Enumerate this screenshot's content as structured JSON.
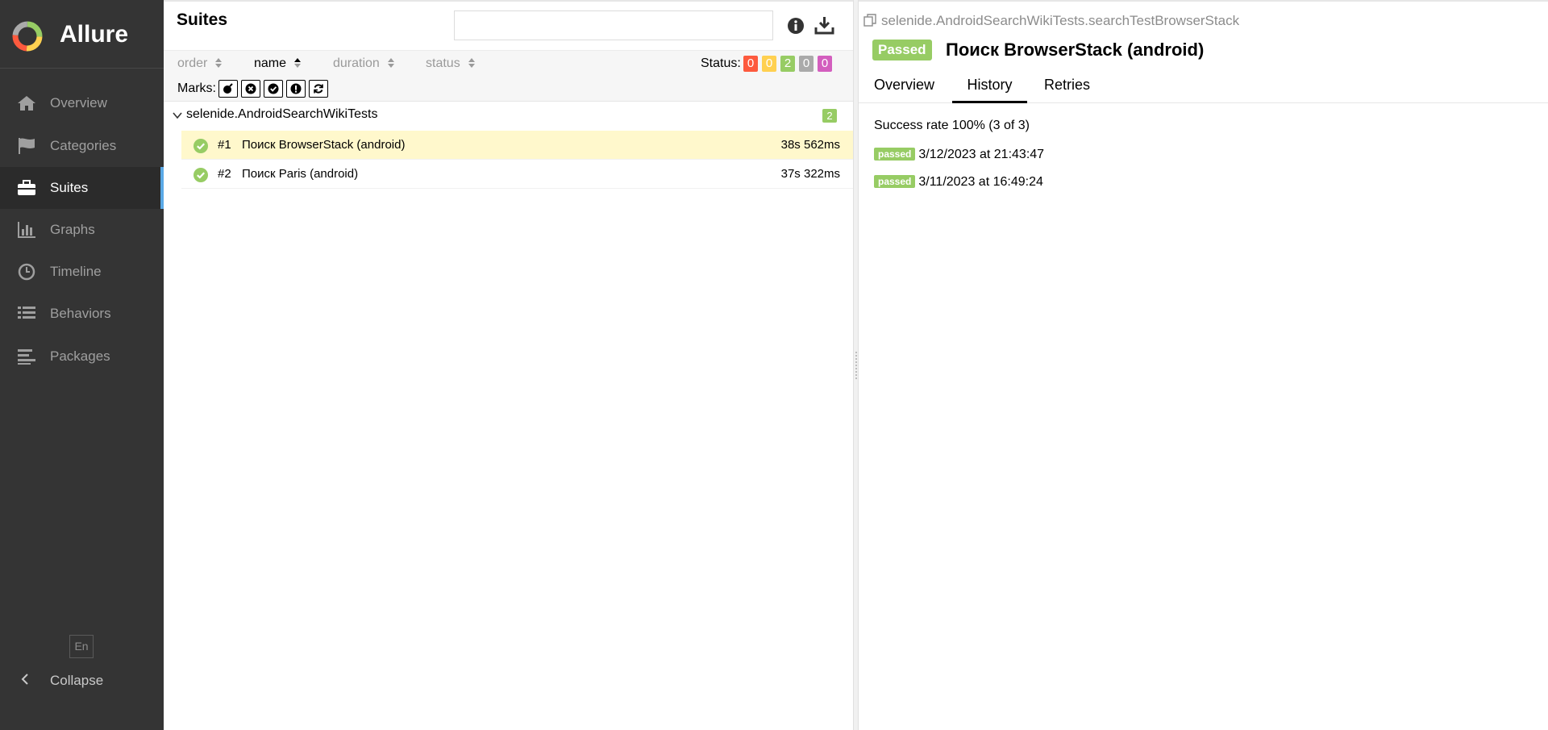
{
  "app": {
    "brand": "Allure"
  },
  "sidebar": {
    "items": [
      {
        "label": "Overview",
        "icon": "home-icon",
        "active": false
      },
      {
        "label": "Categories",
        "icon": "flag-icon",
        "active": false
      },
      {
        "label": "Suites",
        "icon": "briefcase-icon",
        "active": true
      },
      {
        "label": "Graphs",
        "icon": "bar-chart-icon",
        "active": false
      },
      {
        "label": "Timeline",
        "icon": "clock-icon",
        "active": false
      },
      {
        "label": "Behaviors",
        "icon": "list-icon",
        "active": false
      },
      {
        "label": "Packages",
        "icon": "align-left-icon",
        "active": false
      }
    ],
    "language": "En",
    "collapse_label": "Collapse"
  },
  "suites": {
    "title": "Suites",
    "search": {
      "value": "",
      "placeholder": ""
    },
    "sort": {
      "order": "order",
      "name": "name",
      "duration": "duration",
      "status": "status",
      "active": "name"
    },
    "status_label": "Status:",
    "status_counts": [
      {
        "value": "0",
        "color": "#fd5a3e"
      },
      {
        "value": "0",
        "color": "#ffd050"
      },
      {
        "value": "2",
        "color": "#97cc64"
      },
      {
        "value": "0",
        "color": "#aaaaaa"
      },
      {
        "value": "0",
        "color": "#d35ebe"
      }
    ],
    "marks_label": "Marks:",
    "marks": [
      "flaky-icon",
      "new-failed-icon",
      "new-passed-icon",
      "new-broken-icon",
      "retries-icon"
    ],
    "group": {
      "name": "selenide.AndroidSearchWikiTests",
      "count": "2"
    },
    "tests": [
      {
        "num": "#1",
        "name": "Поиск BrowserStack (android)",
        "duration": "38s 562ms",
        "selected": true
      },
      {
        "num": "#2",
        "name": "Поиск Paris (android)",
        "duration": "37s 322ms",
        "selected": false
      }
    ]
  },
  "test": {
    "full_name": "selenide.AndroidSearchWikiTests.searchTestBrowserStack",
    "status": "Passed",
    "title": "Поиск BrowserStack (android)",
    "tabs": [
      "Overview",
      "History",
      "Retries"
    ],
    "active_tab": "History",
    "success_rate": "Success rate 100% (3 of 3)",
    "history": [
      {
        "status": "passed",
        "time": "3/12/2023 at 21:43:47"
      },
      {
        "status": "passed",
        "time": "3/11/2023 at 16:49:24"
      }
    ]
  }
}
